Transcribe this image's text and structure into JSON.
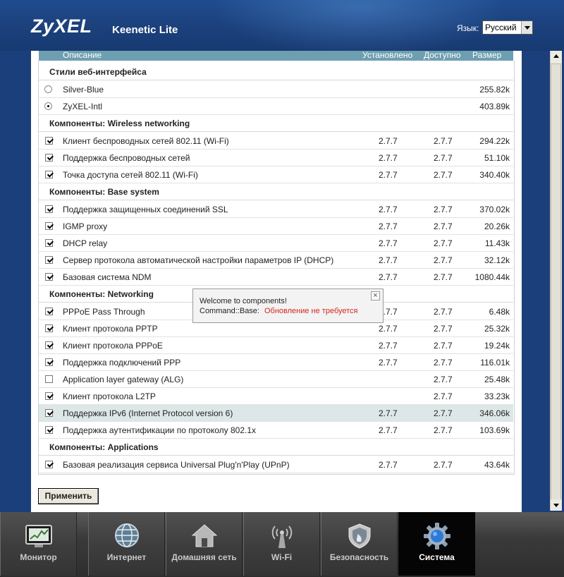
{
  "header": {
    "brand": "ZyXEL",
    "model": "Keenetic Lite",
    "lang_label": "Язык:",
    "lang_value": "Русский"
  },
  "table": {
    "columns": {
      "description": "Описание",
      "installed": "Установлено",
      "available": "Доступно",
      "size": "Размер"
    },
    "groups": [
      {
        "title": "Стили веб-интерфейса"
      },
      {
        "title": "Компоненты: Wireless networking"
      },
      {
        "title": "Компоненты: Base system"
      },
      {
        "title": "Компоненты: Networking"
      },
      {
        "title": "Компоненты: Applications"
      }
    ],
    "rows": [
      {
        "name": "Silver-Blue",
        "installed": "",
        "available": "",
        "size": "255.82k",
        "control": "radio",
        "checked": false
      },
      {
        "name": "ZyXEL-Intl",
        "installed": "",
        "available": "",
        "size": "403.89k",
        "control": "radio",
        "checked": true
      },
      {
        "name": "Клиент беспроводных сетей 802.11 (Wi-Fi)",
        "installed": "2.7.7",
        "available": "2.7.7",
        "size": "294.22k",
        "control": "checkbox",
        "checked": true
      },
      {
        "name": "Поддержка беспроводных сетей",
        "installed": "2.7.7",
        "available": "2.7.7",
        "size": "51.10k",
        "control": "checkbox",
        "checked": true
      },
      {
        "name": "Точка доступа сетей 802.11 (Wi-Fi)",
        "installed": "2.7.7",
        "available": "2.7.7",
        "size": "340.40k",
        "control": "checkbox",
        "checked": true
      },
      {
        "name": "Поддержка защищенных соединений SSL",
        "installed": "2.7.7",
        "available": "2.7.7",
        "size": "370.02k",
        "control": "checkbox",
        "checked": true
      },
      {
        "name": "IGMP proxy",
        "installed": "2.7.7",
        "available": "2.7.7",
        "size": "20.26k",
        "control": "checkbox",
        "checked": true
      },
      {
        "name": "DHCP relay",
        "installed": "2.7.7",
        "available": "2.7.7",
        "size": "11.43k",
        "control": "checkbox",
        "checked": true
      },
      {
        "name": "Сервер протокола автоматической настройки параметров IP (DHCP)",
        "installed": "2.7.7",
        "available": "2.7.7",
        "size": "32.12k",
        "control": "checkbox",
        "checked": true
      },
      {
        "name": "Базовая система NDM",
        "installed": "2.7.7",
        "available": "2.7.7",
        "size": "1080.44k",
        "control": "checkbox",
        "checked": true
      },
      {
        "name": "PPPoE Pass Through",
        "installed": "2.7.7",
        "available": "2.7.7",
        "size": "6.48k",
        "control": "checkbox",
        "checked": true
      },
      {
        "name": "Клиент протокола PPTP",
        "installed": "2.7.7",
        "available": "2.7.7",
        "size": "25.32k",
        "control": "checkbox",
        "checked": true
      },
      {
        "name": "Клиент протокола PPPoE",
        "installed": "2.7.7",
        "available": "2.7.7",
        "size": "19.24k",
        "control": "checkbox",
        "checked": true
      },
      {
        "name": "Поддержка подключений PPP",
        "installed": "2.7.7",
        "available": "2.7.7",
        "size": "116.01k",
        "control": "checkbox",
        "checked": true
      },
      {
        "name": "Application layer gateway (ALG)",
        "installed": "",
        "available": "2.7.7",
        "size": "25.48k",
        "control": "checkbox",
        "checked": false
      },
      {
        "name": "Клиент протокола L2TP",
        "installed": "",
        "available": "2.7.7",
        "size": "33.23k",
        "control": "checkbox",
        "checked": true
      },
      {
        "name": "Поддержка IPv6 (Internet Protocol version 6)",
        "installed": "2.7.7",
        "available": "2.7.7",
        "size": "346.06k",
        "control": "checkbox",
        "checked": true,
        "highlighted": true
      },
      {
        "name": "Поддержка аутентификации по протоколу 802.1x",
        "installed": "2.7.7",
        "available": "2.7.7",
        "size": "103.69k",
        "control": "checkbox",
        "checked": true
      },
      {
        "name": "Базовая реализация сервиса Universal Plug'n'Play (UPnP)",
        "installed": "2.7.7",
        "available": "2.7.7",
        "size": "43.64k",
        "control": "checkbox",
        "checked": true
      }
    ]
  },
  "apply_label": "Применить",
  "popup": {
    "line1": "Welcome to components!",
    "line2_prefix": "Command::Base:",
    "line2_error": "Обновление не требуется",
    "close": "×",
    "error_color": "#d4261d"
  },
  "nav": {
    "tabs": [
      {
        "label": "Монитор",
        "icon": "monitor-icon"
      },
      {
        "label": "Интернет",
        "icon": "globe-icon"
      },
      {
        "label": "Домашняя сеть",
        "icon": "home-icon"
      },
      {
        "label": "Wi-Fi",
        "icon": "wifi-antenna-icon"
      },
      {
        "label": "Безопасность",
        "icon": "shield-icon"
      },
      {
        "label": "Система",
        "icon": "gear-icon",
        "active": true
      }
    ]
  }
}
